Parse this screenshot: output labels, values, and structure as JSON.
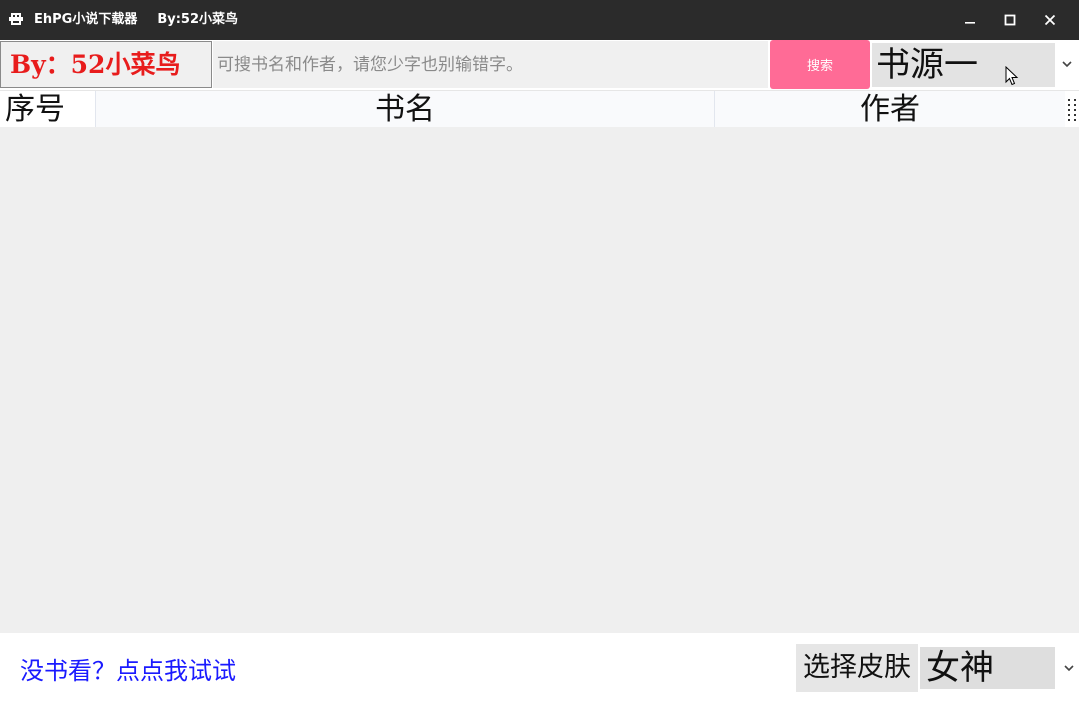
{
  "window": {
    "title": "EhPG小说下载器",
    "subtitle": "By:52小菜鸟",
    "icon": "app-icon",
    "controls": [
      "minimize-icon",
      "maximize-icon",
      "close-icon"
    ]
  },
  "toolbar": {
    "brand": "By：52小菜鸟",
    "search_placeholder": "可搜书名和作者，请您少字也别输错字。",
    "search_value": "",
    "search_button": "搜索",
    "source_selected": "书源一"
  },
  "table": {
    "columns": [
      "序号",
      "书名",
      "作者"
    ],
    "rows": []
  },
  "footer": {
    "no_book_link": "没书看？点点我试试",
    "skin_label": "选择皮肤",
    "skin_selected": "女神"
  },
  "colors": {
    "titlebar": "#2b2b2b",
    "brand_text": "#e81c1c",
    "search_button": "#ff6b96",
    "link": "#1a1aff",
    "table_body": "#efefef"
  }
}
